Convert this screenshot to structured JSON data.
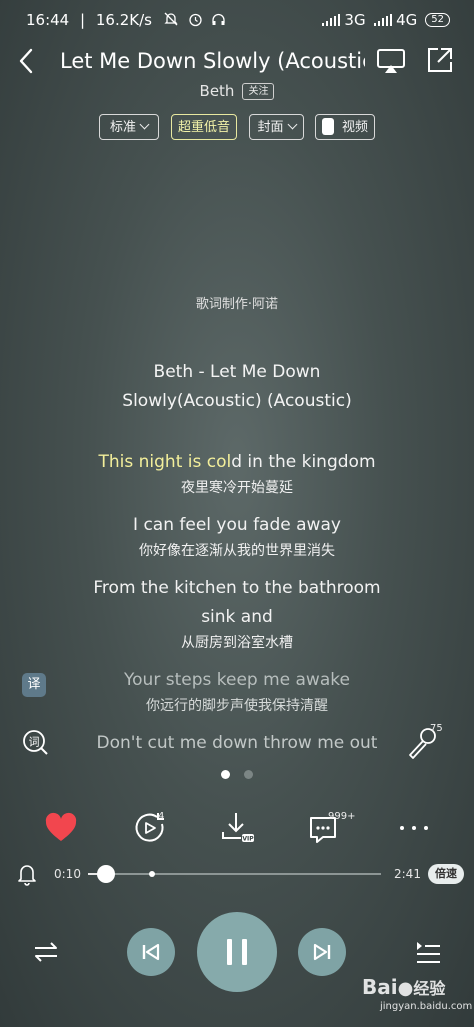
{
  "status_bar": {
    "time": "16:44",
    "net_speed": "16.2K/s",
    "net_3g": "3G",
    "net_4g": "4G",
    "battery": "52"
  },
  "header": {
    "title": "Let Me Down Slowly (Acoustic)",
    "artist": "Beth",
    "follow_label": "关注"
  },
  "options": {
    "quality": "标准",
    "effect": "超重低音",
    "cover": "封面",
    "video": "视频"
  },
  "lyrics": {
    "credit": "歌词制作·阿诺",
    "song_heading_1": "Beth - Let Me Down",
    "song_heading_2": "Slowly(Acoustic) (Acoustic)",
    "lines": [
      {
        "en_sung": "This night is col",
        "en_rest": "d in the kingdom",
        "zh": "夜里寒冷开始蔓延"
      },
      {
        "en": "I can feel you fade away",
        "zh": "你好像在逐渐从我的世界里消失"
      },
      {
        "en": "From the kitchen to the bathroom",
        "en2": "sink and",
        "zh": "从厨房到浴室水槽"
      },
      {
        "en": "Your steps keep me awake",
        "zh": "你远行的脚步声使我保持清醒"
      },
      {
        "en": "Don't cut me down throw me out"
      }
    ]
  },
  "side_icons": {
    "translate_label": "译",
    "lyrics_search_label": "词",
    "mic_count": "75"
  },
  "actions": {
    "playlist_count": "4",
    "comment_count": "999+"
  },
  "progress": {
    "current": "0:10",
    "total": "2:41",
    "speed_label": "倍速",
    "fraction": 0.062,
    "buffered_fraction": 0.22
  },
  "watermark": {
    "brand": "Bai",
    "brand_tail": "经验",
    "url": "jingyan.baidu.com"
  },
  "colors": {
    "lyric_highlight": "#f3ef9b",
    "like_heart": "#f2464e",
    "control_circle": "#7fa3a5"
  }
}
